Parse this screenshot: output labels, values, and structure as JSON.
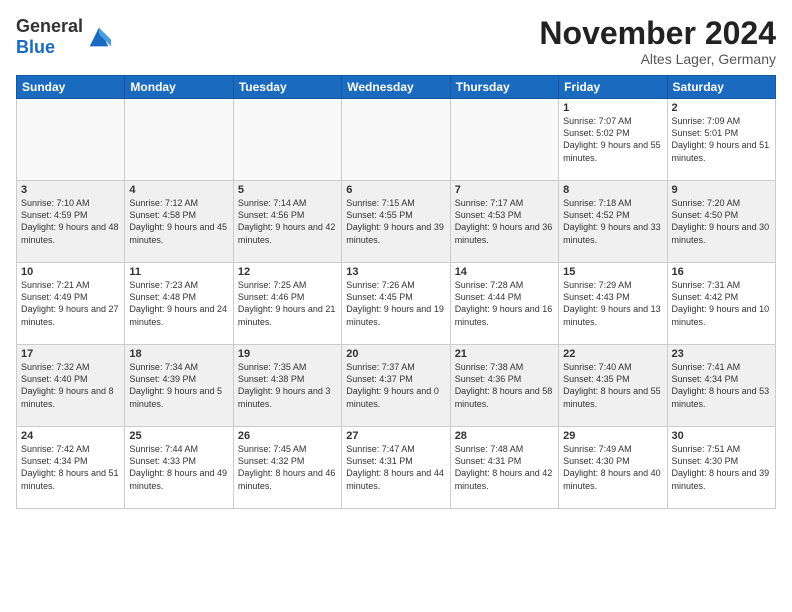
{
  "logo": {
    "general": "General",
    "blue": "Blue"
  },
  "header": {
    "title": "November 2024",
    "location": "Altes Lager, Germany"
  },
  "weekdays": [
    "Sunday",
    "Monday",
    "Tuesday",
    "Wednesday",
    "Thursday",
    "Friday",
    "Saturday"
  ],
  "weeks": [
    [
      {
        "day": "",
        "info": ""
      },
      {
        "day": "",
        "info": ""
      },
      {
        "day": "",
        "info": ""
      },
      {
        "day": "",
        "info": ""
      },
      {
        "day": "",
        "info": ""
      },
      {
        "day": "1",
        "info": "Sunrise: 7:07 AM\nSunset: 5:02 PM\nDaylight: 9 hours and 55 minutes."
      },
      {
        "day": "2",
        "info": "Sunrise: 7:09 AM\nSunset: 5:01 PM\nDaylight: 9 hours and 51 minutes."
      }
    ],
    [
      {
        "day": "3",
        "info": "Sunrise: 7:10 AM\nSunset: 4:59 PM\nDaylight: 9 hours and 48 minutes."
      },
      {
        "day": "4",
        "info": "Sunrise: 7:12 AM\nSunset: 4:58 PM\nDaylight: 9 hours and 45 minutes."
      },
      {
        "day": "5",
        "info": "Sunrise: 7:14 AM\nSunset: 4:56 PM\nDaylight: 9 hours and 42 minutes."
      },
      {
        "day": "6",
        "info": "Sunrise: 7:15 AM\nSunset: 4:55 PM\nDaylight: 9 hours and 39 minutes."
      },
      {
        "day": "7",
        "info": "Sunrise: 7:17 AM\nSunset: 4:53 PM\nDaylight: 9 hours and 36 minutes."
      },
      {
        "day": "8",
        "info": "Sunrise: 7:18 AM\nSunset: 4:52 PM\nDaylight: 9 hours and 33 minutes."
      },
      {
        "day": "9",
        "info": "Sunrise: 7:20 AM\nSunset: 4:50 PM\nDaylight: 9 hours and 30 minutes."
      }
    ],
    [
      {
        "day": "10",
        "info": "Sunrise: 7:21 AM\nSunset: 4:49 PM\nDaylight: 9 hours and 27 minutes."
      },
      {
        "day": "11",
        "info": "Sunrise: 7:23 AM\nSunset: 4:48 PM\nDaylight: 9 hours and 24 minutes."
      },
      {
        "day": "12",
        "info": "Sunrise: 7:25 AM\nSunset: 4:46 PM\nDaylight: 9 hours and 21 minutes."
      },
      {
        "day": "13",
        "info": "Sunrise: 7:26 AM\nSunset: 4:45 PM\nDaylight: 9 hours and 19 minutes."
      },
      {
        "day": "14",
        "info": "Sunrise: 7:28 AM\nSunset: 4:44 PM\nDaylight: 9 hours and 16 minutes."
      },
      {
        "day": "15",
        "info": "Sunrise: 7:29 AM\nSunset: 4:43 PM\nDaylight: 9 hours and 13 minutes."
      },
      {
        "day": "16",
        "info": "Sunrise: 7:31 AM\nSunset: 4:42 PM\nDaylight: 9 hours and 10 minutes."
      }
    ],
    [
      {
        "day": "17",
        "info": "Sunrise: 7:32 AM\nSunset: 4:40 PM\nDaylight: 9 hours and 8 minutes."
      },
      {
        "day": "18",
        "info": "Sunrise: 7:34 AM\nSunset: 4:39 PM\nDaylight: 9 hours and 5 minutes."
      },
      {
        "day": "19",
        "info": "Sunrise: 7:35 AM\nSunset: 4:38 PM\nDaylight: 9 hours and 3 minutes."
      },
      {
        "day": "20",
        "info": "Sunrise: 7:37 AM\nSunset: 4:37 PM\nDaylight: 9 hours and 0 minutes."
      },
      {
        "day": "21",
        "info": "Sunrise: 7:38 AM\nSunset: 4:36 PM\nDaylight: 8 hours and 58 minutes."
      },
      {
        "day": "22",
        "info": "Sunrise: 7:40 AM\nSunset: 4:35 PM\nDaylight: 8 hours and 55 minutes."
      },
      {
        "day": "23",
        "info": "Sunrise: 7:41 AM\nSunset: 4:34 PM\nDaylight: 8 hours and 53 minutes."
      }
    ],
    [
      {
        "day": "24",
        "info": "Sunrise: 7:42 AM\nSunset: 4:34 PM\nDaylight: 8 hours and 51 minutes."
      },
      {
        "day": "25",
        "info": "Sunrise: 7:44 AM\nSunset: 4:33 PM\nDaylight: 8 hours and 49 minutes."
      },
      {
        "day": "26",
        "info": "Sunrise: 7:45 AM\nSunset: 4:32 PM\nDaylight: 8 hours and 46 minutes."
      },
      {
        "day": "27",
        "info": "Sunrise: 7:47 AM\nSunset: 4:31 PM\nDaylight: 8 hours and 44 minutes."
      },
      {
        "day": "28",
        "info": "Sunrise: 7:48 AM\nSunset: 4:31 PM\nDaylight: 8 hours and 42 minutes."
      },
      {
        "day": "29",
        "info": "Sunrise: 7:49 AM\nSunset: 4:30 PM\nDaylight: 8 hours and 40 minutes."
      },
      {
        "day": "30",
        "info": "Sunrise: 7:51 AM\nSunset: 4:30 PM\nDaylight: 8 hours and 39 minutes."
      }
    ]
  ]
}
